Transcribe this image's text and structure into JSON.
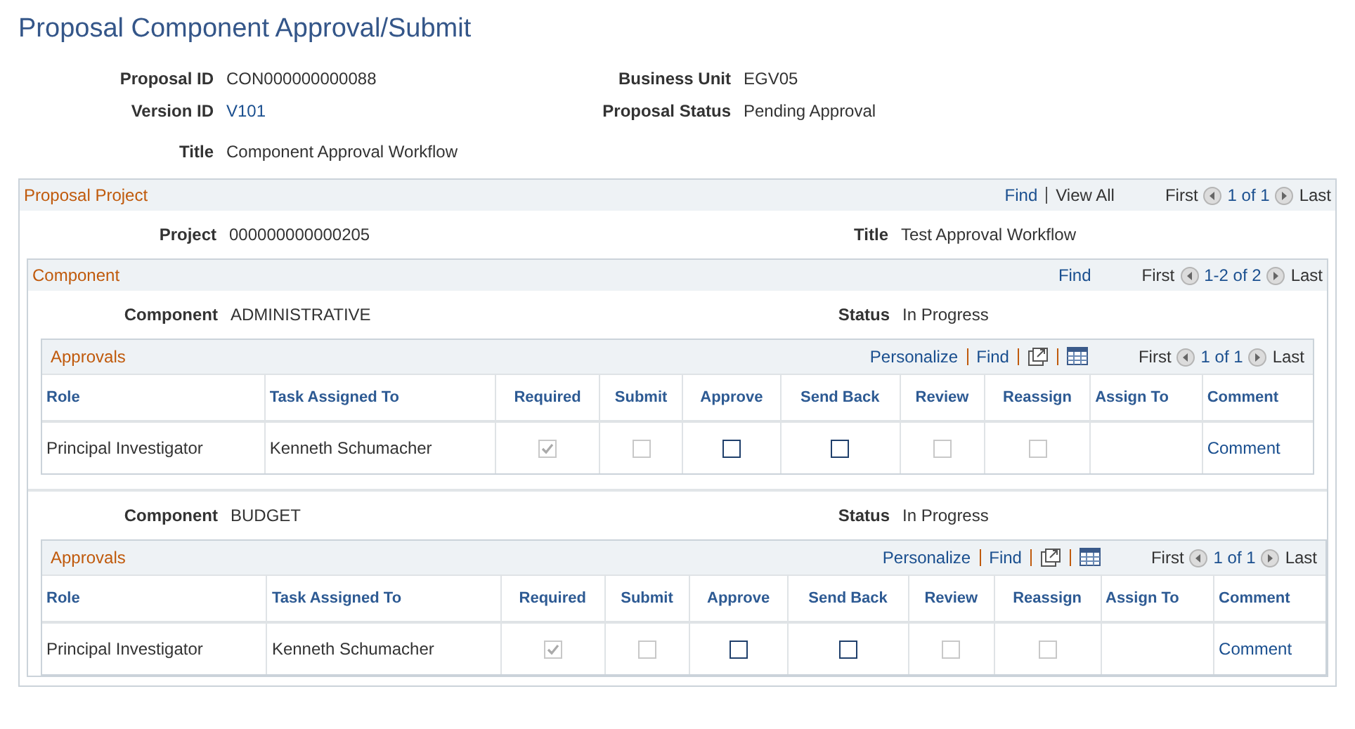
{
  "page_title": "Proposal Component Approval/Submit",
  "header_fields": [
    {
      "label": "Proposal ID",
      "value": "CON000000000088",
      "kind": "text"
    },
    {
      "label": "Business Unit",
      "value": "EGV05",
      "kind": "text"
    },
    {
      "label": "Version ID",
      "value": "V101",
      "kind": "link"
    },
    {
      "label": "Proposal Status",
      "value": "Pending Approval",
      "kind": "text"
    },
    {
      "label": "Title",
      "value": "Component Approval Workflow",
      "kind": "text"
    }
  ],
  "proposal_project": {
    "title": "Proposal Project",
    "nav": {
      "links": [
        "Find",
        "View All"
      ],
      "first": "First",
      "range": "1 of 1",
      "last": "Last"
    },
    "fields": [
      {
        "label": "Project",
        "value": "000000000000205"
      },
      {
        "label": "Title",
        "value": "Test Approval Workflow"
      }
    ],
    "component_section": {
      "title": "Component",
      "nav": {
        "links": [
          "Find"
        ],
        "first": "First",
        "range": "1-2 of 2",
        "last": "Last"
      },
      "components": [
        {
          "fields": [
            {
              "label": "Component",
              "value": "ADMINISTRATIVE"
            },
            {
              "label": "Status",
              "value": "In Progress"
            }
          ],
          "approvals": {
            "title": "Approvals",
            "links": [
              "Personalize",
              "Find"
            ],
            "first": "First",
            "range": "1 of 1",
            "last": "Last",
            "columns": [
              "Role",
              "Task Assigned To",
              "Required",
              "Submit",
              "Approve",
              "Send Back",
              "Review",
              "Reassign",
              "Assign To",
              "Comment"
            ],
            "rows": [
              {
                "cells": [
                  {
                    "kind": "text",
                    "text": "Principal Investigator"
                  },
                  {
                    "kind": "text",
                    "text": "Kenneth Schumacher"
                  },
                  {
                    "kind": "checkbox",
                    "checked": true,
                    "disabled": true
                  },
                  {
                    "kind": "checkbox",
                    "checked": false,
                    "disabled": true
                  },
                  {
                    "kind": "checkbox",
                    "checked": false,
                    "disabled": false
                  },
                  {
                    "kind": "checkbox",
                    "checked": false,
                    "disabled": false
                  },
                  {
                    "kind": "checkbox",
                    "checked": false,
                    "disabled": true
                  },
                  {
                    "kind": "checkbox",
                    "checked": false,
                    "disabled": true
                  },
                  {
                    "kind": "empty"
                  },
                  {
                    "kind": "link",
                    "text": "Comment"
                  }
                ]
              }
            ]
          }
        },
        {
          "fields": [
            {
              "label": "Component",
              "value": "BUDGET"
            },
            {
              "label": "Status",
              "value": "In Progress"
            }
          ],
          "approvals": {
            "title": "Approvals",
            "links": [
              "Personalize",
              "Find"
            ],
            "first": "First",
            "range": "1 of 1",
            "last": "Last",
            "columns": [
              "Role",
              "Task Assigned To",
              "Required",
              "Submit",
              "Approve",
              "Send Back",
              "Review",
              "Reassign",
              "Assign To",
              "Comment"
            ],
            "rows": [
              {
                "cells": [
                  {
                    "kind": "text",
                    "text": "Principal Investigator"
                  },
                  {
                    "kind": "text",
                    "text": "Kenneth Schumacher"
                  },
                  {
                    "kind": "checkbox",
                    "checked": true,
                    "disabled": true
                  },
                  {
                    "kind": "checkbox",
                    "checked": false,
                    "disabled": true
                  },
                  {
                    "kind": "checkbox",
                    "checked": false,
                    "disabled": false
                  },
                  {
                    "kind": "checkbox",
                    "checked": false,
                    "disabled": false
                  },
                  {
                    "kind": "checkbox",
                    "checked": false,
                    "disabled": true
                  },
                  {
                    "kind": "checkbox",
                    "checked": false,
                    "disabled": true
                  },
                  {
                    "kind": "empty"
                  },
                  {
                    "kind": "link",
                    "text": "Comment"
                  }
                ]
              }
            ]
          }
        }
      ]
    }
  }
}
